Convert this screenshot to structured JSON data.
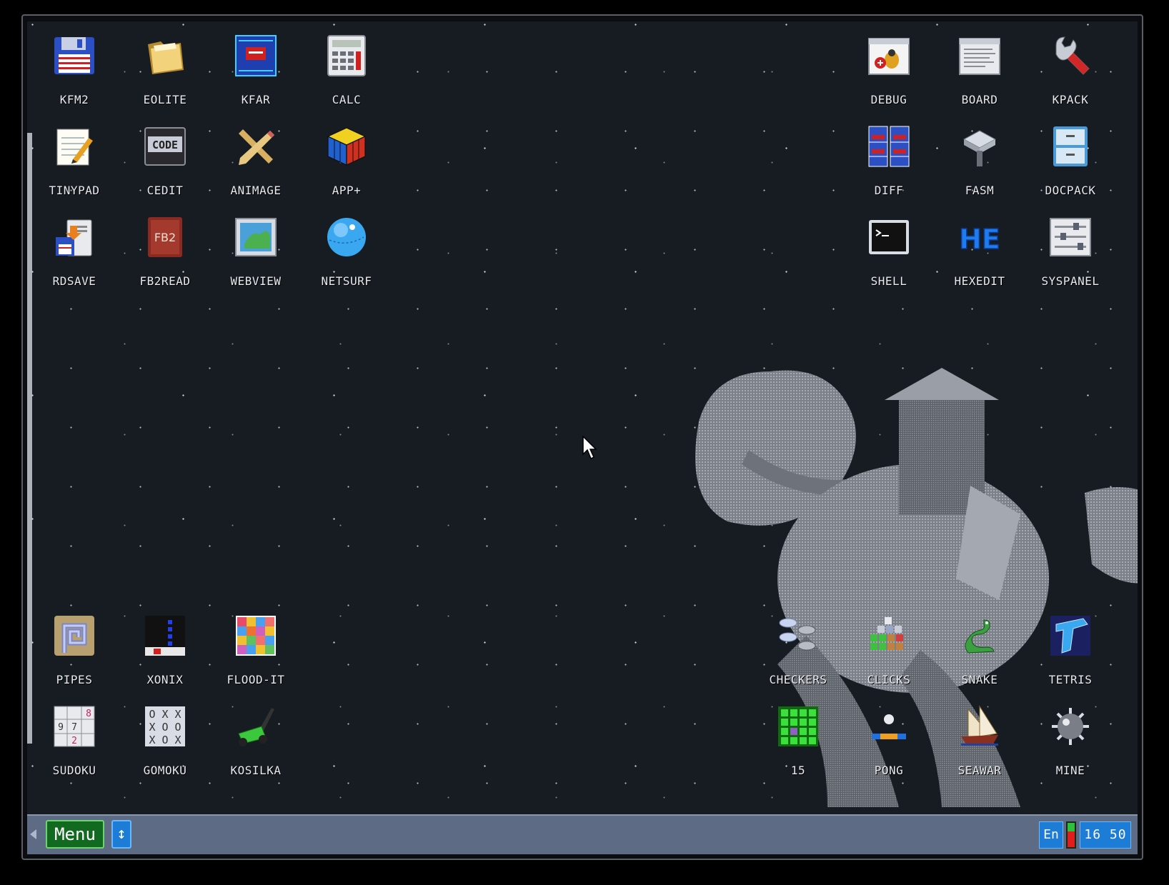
{
  "desktop": {
    "icons_top_left": [
      {
        "label": "KFM2",
        "icon": "floppy-disk-icon"
      },
      {
        "label": "EOLITE",
        "icon": "folder-icon"
      },
      {
        "label": "KFAR",
        "icon": "blue-panel-icon"
      },
      {
        "label": "CALC",
        "icon": "calculator-icon"
      },
      {
        "label": "TINYPAD",
        "icon": "notepad-pencil-icon"
      },
      {
        "label": "CEDIT",
        "icon": "code-icon"
      },
      {
        "label": "ANIMAGE",
        "icon": "pencil-ruler-icon"
      },
      {
        "label": "APP+",
        "icon": "rubiks-cube-icon"
      },
      {
        "label": "RDSAVE",
        "icon": "save-computer-icon"
      },
      {
        "label": "FB2READ",
        "icon": "book-icon"
      },
      {
        "label": "WEBVIEW",
        "icon": "map-picture-icon"
      },
      {
        "label": "NETSURF",
        "icon": "globe-icon"
      }
    ],
    "icons_top_right": [
      {
        "label": "DEBUG",
        "icon": "bug-window-icon"
      },
      {
        "label": "BOARD",
        "icon": "board-window-icon"
      },
      {
        "label": "KPACK",
        "icon": "wrench-icon"
      },
      {
        "label": "DIFF",
        "icon": "diff-grid-icon"
      },
      {
        "label": "FASM",
        "icon": "hammer-anvil-icon"
      },
      {
        "label": "DOCPACK",
        "icon": "cabinet-icon"
      },
      {
        "label": "SHELL",
        "icon": "terminal-icon"
      },
      {
        "label": "HEXEDIT",
        "icon": "hex-icon"
      },
      {
        "label": "SYSPANEL",
        "icon": "sliders-icon"
      }
    ],
    "icons_bottom_left": [
      {
        "label": "PIPES",
        "icon": "pipes-icon"
      },
      {
        "label": "XONIX",
        "icon": "xonix-icon"
      },
      {
        "label": "FLOOD-IT",
        "icon": "color-grid-icon"
      },
      {
        "label": "SUDOKU",
        "icon": "sudoku-icon"
      },
      {
        "label": "GOMOKU",
        "icon": "gomoku-icon"
      },
      {
        "label": "KOSILKA",
        "icon": "lawnmower-icon"
      }
    ],
    "icons_bottom_right": [
      {
        "label": "CHECKERS",
        "icon": "checkers-icon"
      },
      {
        "label": "CLICKS",
        "icon": "clicks-blocks-icon"
      },
      {
        "label": "SNAKE",
        "icon": "snake-icon"
      },
      {
        "label": "TETRIS",
        "icon": "tetris-icon"
      },
      {
        "label": "15",
        "icon": "fifteen-puzzle-icon"
      },
      {
        "label": "PONG",
        "icon": "pong-icon"
      },
      {
        "label": "SEAWAR",
        "icon": "ship-icon"
      },
      {
        "label": "MINE",
        "icon": "mine-icon"
      }
    ]
  },
  "taskbar": {
    "menu_label": "Menu",
    "swap_label": "↕",
    "lang_label": "En",
    "clock_label": "16 50"
  },
  "colors": {
    "desktop_bg": "#161c22",
    "taskbar_bg": "#5e6b84",
    "menu_bg": "#116a1f",
    "accent_blue": "#1d7cd6"
  }
}
